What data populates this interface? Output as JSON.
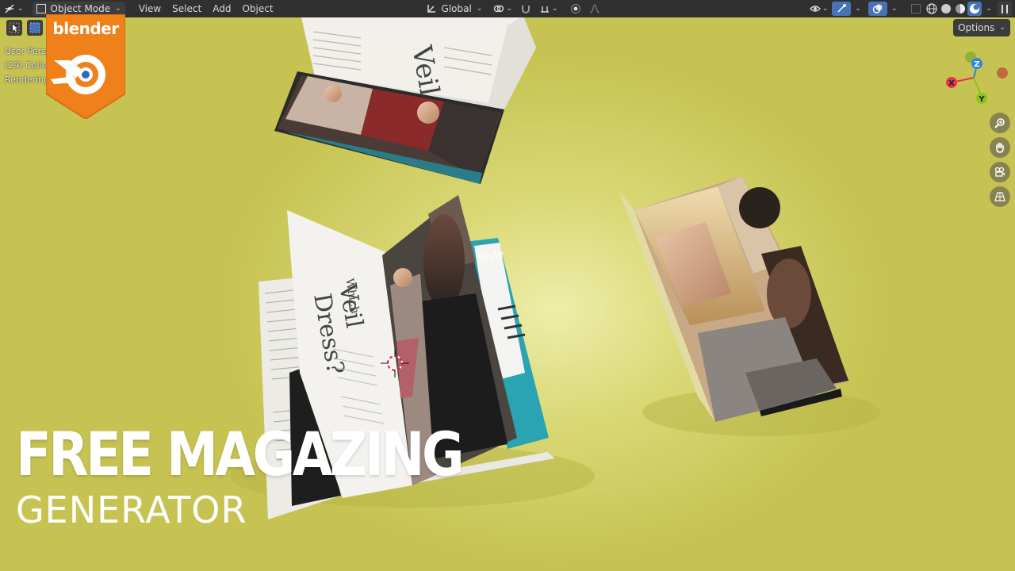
{
  "header": {
    "mode_label": "Object Mode",
    "menus": [
      "View",
      "Select",
      "Add",
      "Object"
    ],
    "transform_orientation": "Global"
  },
  "overlay": {
    "line1": "User Persp",
    "line2": "(29) Colle",
    "line3": "Rendering"
  },
  "options_label": "Options",
  "logo": {
    "text": "blender",
    "brand_color": "#F5821F"
  },
  "gizmo": {
    "x_label": "X",
    "y_label": "Y",
    "z_label": "Z",
    "x_color": "#E5344F",
    "y_color": "#8BC320",
    "z_color": "#2F86E6"
  },
  "nav": {
    "zoom_icon": "zoom-icon",
    "pan_icon": "hand-icon",
    "camera_icon": "camera-icon",
    "ortho_icon": "grid-icon"
  },
  "magazine": {
    "style_label": "Style",
    "headline1": "Which",
    "headline2": "Veil",
    "headline3": "Dress?",
    "top_headline": "Veil"
  },
  "title": {
    "main": "FREE MAGAZING",
    "sub": "GENERATOR"
  },
  "colors": {
    "viewport_bg": "#D9D875",
    "header_bg": "#303030",
    "accent": "#4772B3"
  }
}
